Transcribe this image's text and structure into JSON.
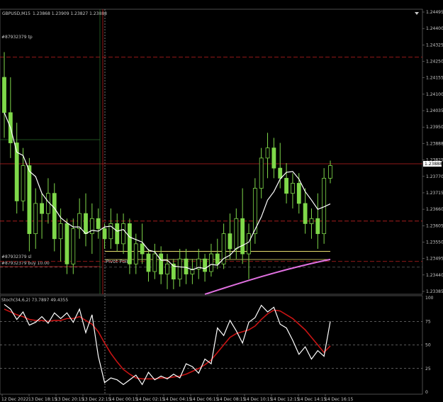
{
  "header": {
    "symbol": "GBPUSD,M15",
    "ohlc": "1.23868 1.23909 1.23827 1.23888"
  },
  "levels": {
    "tp_label": "#87932379 tp",
    "sl_label": "#87932379 sl",
    "buy_label": "#87932379 buy 10.00",
    "pivot_label": "Pivot Point",
    "current_price": "1.23888"
  },
  "price_axis": [
    "1.24495",
    "1.24400",
    "1.24325",
    "1.24250",
    "1.24155",
    "1.24100",
    "1.24035",
    "1.23950",
    "1.23888",
    "1.23825",
    "1.23770",
    "1.23715",
    "1.23660",
    "1.23605",
    "1.23550",
    "1.23495",
    "1.23440",
    "1.23385"
  ],
  "stoch": {
    "label": "Stoch(34,6,2) 73.7897 49.4355",
    "levels": [
      "100",
      "75",
      "50",
      "25",
      "0"
    ]
  },
  "time_axis": [
    "12 Dec 2022",
    "13 Dec 18:15",
    "13 Dec 20:15",
    "13 Dec 22:15",
    "14 Dec 00:15",
    "14 Dec 02:15",
    "14 Dec 04:15",
    "14 Dec 06:15",
    "14 Dec 08:15",
    "14 Dec 10:15",
    "14 Dec 12:15",
    "14 Dec 14:15",
    "14 Dec 16:15"
  ],
  "colors": {
    "bull": "#7fd84a",
    "bear": "#7fd84a",
    "ma": "#ffffff",
    "ma_slow": "#e070e0",
    "stoch_main": "#ffffff",
    "stoch_signal": "#c81414",
    "pivot": "#e8e070",
    "tp_sl": "#c02020"
  },
  "chart_data": {
    "type": "candlestick",
    "symbol": "GBPUSD",
    "timeframe": "M15",
    "ylim": [
      1.2338,
      1.2451
    ],
    "candles": [
      [
        1.2424,
        1.2434,
        1.24,
        1.241
      ],
      [
        1.241,
        1.2424,
        1.2392,
        1.2398
      ],
      [
        1.2398,
        1.2406,
        1.237,
        1.2375
      ],
      [
        1.2375,
        1.2396,
        1.2371,
        1.2389
      ],
      [
        1.2389,
        1.2392,
        1.2355,
        1.2362
      ],
      [
        1.2362,
        1.238,
        1.2356,
        1.2374
      ],
      [
        1.2374,
        1.2378,
        1.236,
        1.237
      ],
      [
        1.237,
        1.2384,
        1.2366,
        1.2378
      ],
      [
        1.2378,
        1.2382,
        1.2355,
        1.236
      ],
      [
        1.236,
        1.2372,
        1.2351,
        1.2366
      ],
      [
        1.2366,
        1.2368,
        1.2346,
        1.235
      ],
      [
        1.235,
        1.2368,
        1.2346,
        1.2364
      ],
      [
        1.2364,
        1.2376,
        1.236,
        1.237
      ],
      [
        1.237,
        1.2378,
        1.2357,
        1.2362
      ],
      [
        1.2362,
        1.2374,
        1.2354,
        1.2368
      ],
      [
        1.2368,
        1.2372,
        1.236,
        1.2364
      ],
      [
        1.2364,
        1.2366,
        1.2356,
        1.236
      ],
      [
        1.236,
        1.2372,
        1.2356,
        1.2366
      ],
      [
        1.2366,
        1.237,
        1.2355,
        1.2358
      ],
      [
        1.2358,
        1.237,
        1.2354,
        1.2366
      ],
      [
        1.2366,
        1.2368,
        1.2346,
        1.235
      ],
      [
        1.235,
        1.2362,
        1.2346,
        1.2358
      ],
      [
        1.2358,
        1.2366,
        1.235,
        1.2354
      ],
      [
        1.2354,
        1.2356,
        1.2343,
        1.2347
      ],
      [
        1.2347,
        1.2358,
        1.2344,
        1.2354
      ],
      [
        1.2354,
        1.2357,
        1.2342,
        1.2346
      ],
      [
        1.2346,
        1.2354,
        1.234,
        1.235
      ],
      [
        1.235,
        1.2352,
        1.234,
        1.2344
      ],
      [
        1.2344,
        1.2356,
        1.2341,
        1.2352
      ],
      [
        1.2352,
        1.2356,
        1.2342,
        1.2346
      ],
      [
        1.2346,
        1.2352,
        1.2342,
        1.2348
      ],
      [
        1.2348,
        1.2356,
        1.2344,
        1.2352
      ],
      [
        1.2352,
        1.2354,
        1.2343,
        1.2347
      ],
      [
        1.2347,
        1.2358,
        1.2345,
        1.2354
      ],
      [
        1.2354,
        1.236,
        1.2348,
        1.235
      ],
      [
        1.235,
        1.2366,
        1.2348,
        1.2362
      ],
      [
        1.2362,
        1.237,
        1.2352,
        1.2356
      ],
      [
        1.2356,
        1.2372,
        1.2352,
        1.2368
      ],
      [
        1.2368,
        1.238,
        1.235,
        1.2354
      ],
      [
        1.2354,
        1.2366,
        1.2344,
        1.2362
      ],
      [
        1.2362,
        1.2384,
        1.2358,
        1.238
      ],
      [
        1.238,
        1.2396,
        1.2376,
        1.2392
      ],
      [
        1.2392,
        1.2402,
        1.2384,
        1.2396
      ],
      [
        1.2396,
        1.24,
        1.2384,
        1.2388
      ],
      [
        1.2388,
        1.2398,
        1.238,
        1.2384
      ],
      [
        1.2384,
        1.239,
        1.2374,
        1.2378
      ],
      [
        1.2378,
        1.2386,
        1.2372,
        1.2382
      ],
      [
        1.2382,
        1.2386,
        1.237,
        1.2374
      ],
      [
        1.2374,
        1.238,
        1.2362,
        1.2366
      ],
      [
        1.2366,
        1.2372,
        1.236,
        1.2368
      ],
      [
        1.2368,
        1.2378,
        1.2356,
        1.2362
      ],
      [
        1.2362,
        1.2388,
        1.2358,
        1.2384
      ],
      [
        1.2384,
        1.2391,
        1.2382,
        1.2389
      ]
    ],
    "pivot_level": 1.2355,
    "tp_level": 1.2432,
    "sl_level": 1.2351,
    "buy_level": 1.2349,
    "extra_level": 1.2367,
    "stoch_main": [
      93,
      88,
      77,
      85,
      71,
      74,
      80,
      73,
      84,
      78,
      84,
      74,
      88,
      63,
      82,
      38,
      10,
      15,
      13,
      8,
      13,
      18,
      8,
      21,
      13,
      17,
      14,
      19,
      15,
      30,
      27,
      20,
      35,
      30,
      68,
      60,
      76,
      65,
      52,
      74,
      79,
      92,
      85,
      90,
      72,
      68,
      55,
      40,
      48,
      35,
      44,
      38,
      75
    ],
    "stoch_signal": [
      88,
      85,
      82,
      80,
      77,
      76,
      76,
      75,
      76,
      76,
      78,
      78,
      80,
      76,
      72,
      64,
      52,
      41,
      32,
      24,
      19,
      15,
      14,
      14,
      14,
      15,
      15,
      16,
      17,
      19,
      22,
      25,
      29,
      34,
      42,
      50,
      58,
      62,
      64,
      66,
      70,
      77,
      83,
      87,
      86,
      82,
      78,
      72,
      66,
      58,
      50,
      42,
      49
    ]
  }
}
